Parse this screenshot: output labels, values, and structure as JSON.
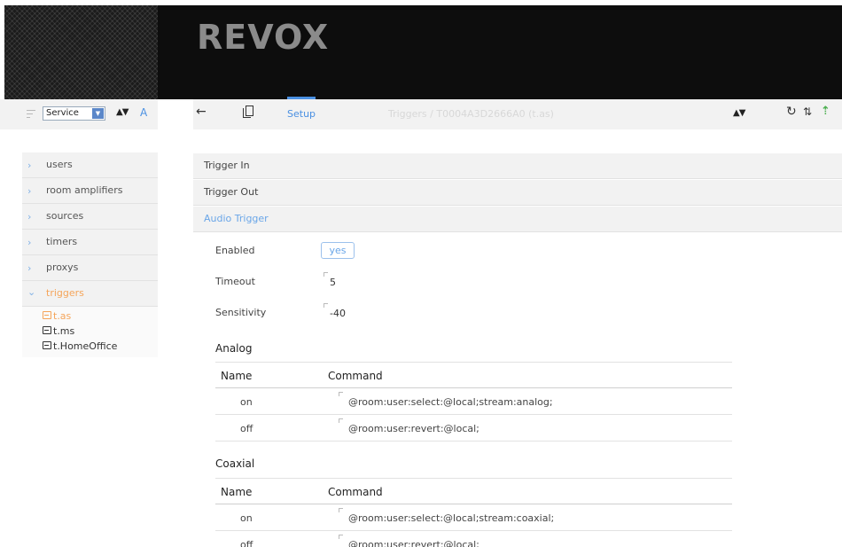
{
  "brand": {
    "logo": "REVOX"
  },
  "left_toolbar": {
    "select_value": "Service",
    "sort_icon": "sort-updown-icon",
    "font_label": "A"
  },
  "toolbar": {
    "back_icon": "arrow-left-icon",
    "copy_icon": "copy-icon",
    "tab_setup": "Setup",
    "breadcrumb": "Triggers / T0004A3D2666A0 (t.as)",
    "sort_icon": "sort-updown-icon",
    "refresh_icon": "refresh-icon",
    "swap_icon": "swap-icon",
    "upload_icon": "upload-icon",
    "accent": "#4a90e2",
    "upload_color": "#4caf50"
  },
  "sidebar": {
    "items": [
      {
        "label": "users"
      },
      {
        "label": "room amplifiers"
      },
      {
        "label": "sources"
      },
      {
        "label": "timers"
      },
      {
        "label": "proxys"
      },
      {
        "label": "triggers"
      }
    ],
    "sub_items": [
      {
        "label": "t.as"
      },
      {
        "label": "t.ms"
      },
      {
        "label": "t.HomeOffice"
      }
    ],
    "active_color": "#f5a55a"
  },
  "sections": {
    "trigger_in": "Trigger In",
    "trigger_out": "Trigger Out",
    "audio_trigger": "Audio Trigger"
  },
  "form": {
    "enabled_label": "Enabled",
    "enabled_value": "yes",
    "timeout_label": "Timeout",
    "timeout_value": "5",
    "sensitivity_label": "Sensitivity",
    "sensitivity_value": "-40"
  },
  "analog": {
    "title": "Analog",
    "col_name": "Name",
    "col_command": "Command",
    "rows": [
      {
        "name": "on",
        "command": "@room:user:select:@local;stream:analog;"
      },
      {
        "name": "off",
        "command": "@room:user:revert:@local;"
      }
    ]
  },
  "coaxial": {
    "title": "Coaxial",
    "col_name": "Name",
    "col_command": "Command",
    "rows": [
      {
        "name": "on",
        "command": "@room:user:select:@local;stream:coaxial;"
      },
      {
        "name": "off",
        "command": "@room:user:revert:@local;"
      }
    ]
  }
}
